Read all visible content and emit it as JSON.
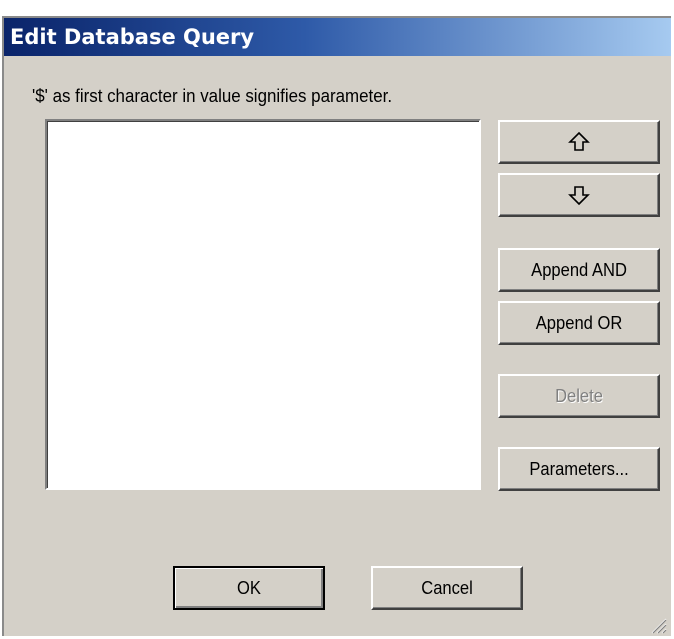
{
  "dialog": {
    "title": "Edit Database Query",
    "hint": "'$' as first character in value signifies parameter."
  },
  "buttons": {
    "move_up_icon": "up-arrow-icon",
    "move_down_icon": "down-arrow-icon",
    "append_and": "Append AND",
    "append_or": "Append OR",
    "delete": "Delete",
    "parameters": "Parameters...",
    "ok": "OK",
    "cancel": "Cancel"
  },
  "colors": {
    "title_start": "#0a246a",
    "title_end": "#a6caf0",
    "face": "#d4d0c8",
    "disabled_text": "#808080"
  }
}
